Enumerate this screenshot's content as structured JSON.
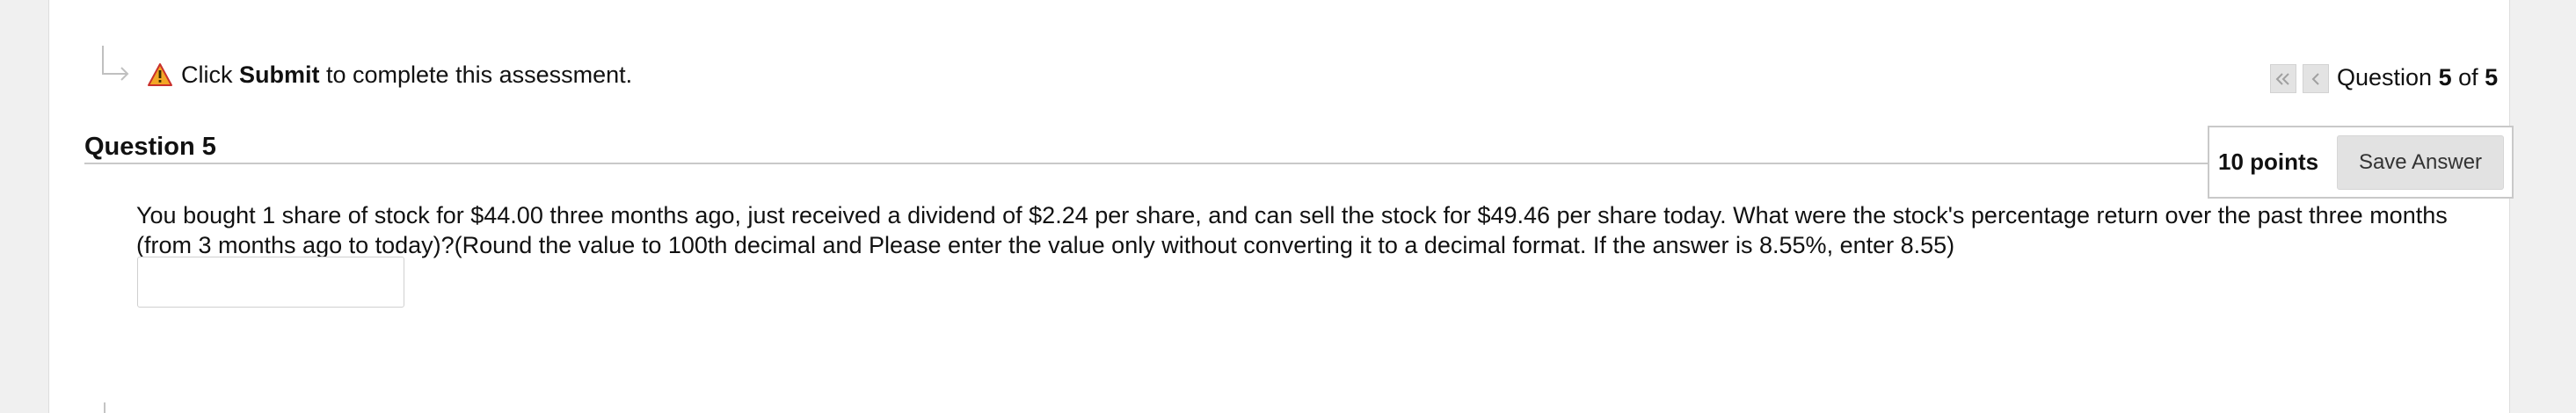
{
  "notice": {
    "prefix": "Click ",
    "action": "Submit",
    "suffix": " to complete this assessment."
  },
  "navigation": {
    "first_icon": "double-chevron-left-icon",
    "prev_icon": "chevron-left-icon",
    "counter_prefix": "Question ",
    "current": "5",
    "counter_sep": " of ",
    "total": "5"
  },
  "question": {
    "title": "Question 5",
    "points": "10 points",
    "save_label": "Save Answer",
    "text": "You bought 1 share of stock for $44.00 three months ago, just received a dividend of $2.24 per share, and can sell the stock for $49.46 per share today. What were the stock's percentage return over the past three months (from 3 months ago to today)?(Round the value to 100th decimal and Please enter the value only without converting it to a decimal format. If the answer is 8.55%, enter 8.55)",
    "answer_value": ""
  },
  "colors": {
    "background": "#f0f0f0",
    "panel": "#ffffff",
    "warning": "#e8a020",
    "button": "#e2e2e2"
  },
  "icons": {
    "connector": "corner-arrow-icon",
    "warning": "warning-icon"
  }
}
